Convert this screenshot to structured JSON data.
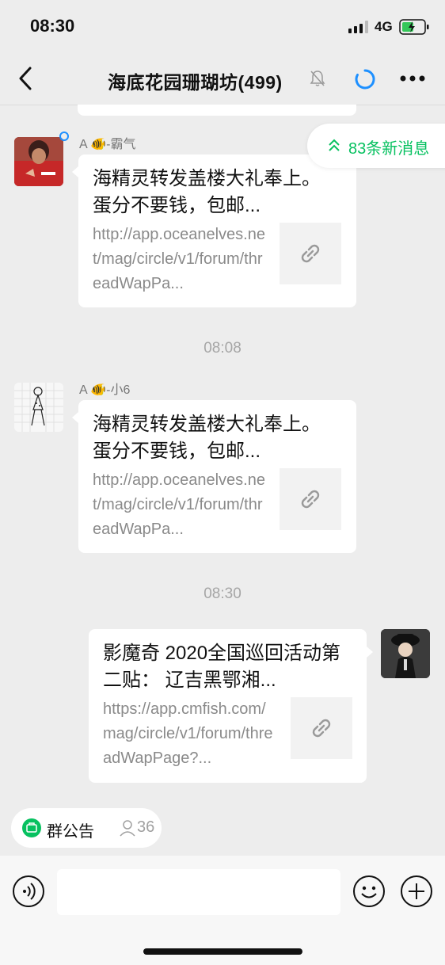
{
  "status": {
    "time": "08:30",
    "network": "4G"
  },
  "header": {
    "title": "海底花园珊瑚坊(499)"
  },
  "new_messages": {
    "label": "83条新消息"
  },
  "messages": [
    {
      "sender": "A 🐠-霸气",
      "title": "海精灵转发盖楼大礼奉上。蛋分不要钱，包邮...",
      "url": "http://app.oceanelves.net/mag/circle/v1/forum/threadWapPa..."
    },
    {
      "timestamp": "08:08"
    },
    {
      "sender": "A 🐠-小6",
      "title": "海精灵转发盖楼大礼奉上。蛋分不要钱，包邮...",
      "url": "http://app.oceanelves.net/mag/circle/v1/forum/threadWapPa..."
    },
    {
      "timestamp": "08:30"
    },
    {
      "title": "影魔奇 2020全国巡回活动第二贴： 辽吉黑鄂湘...",
      "url": "https://app.cmfish.com/mag/circle/v1/forum/threadWapPage?..."
    }
  ],
  "announcement": {
    "label": "群公告",
    "count": "36"
  },
  "colors": {
    "accent": "#07c160",
    "background": "#ededed"
  }
}
